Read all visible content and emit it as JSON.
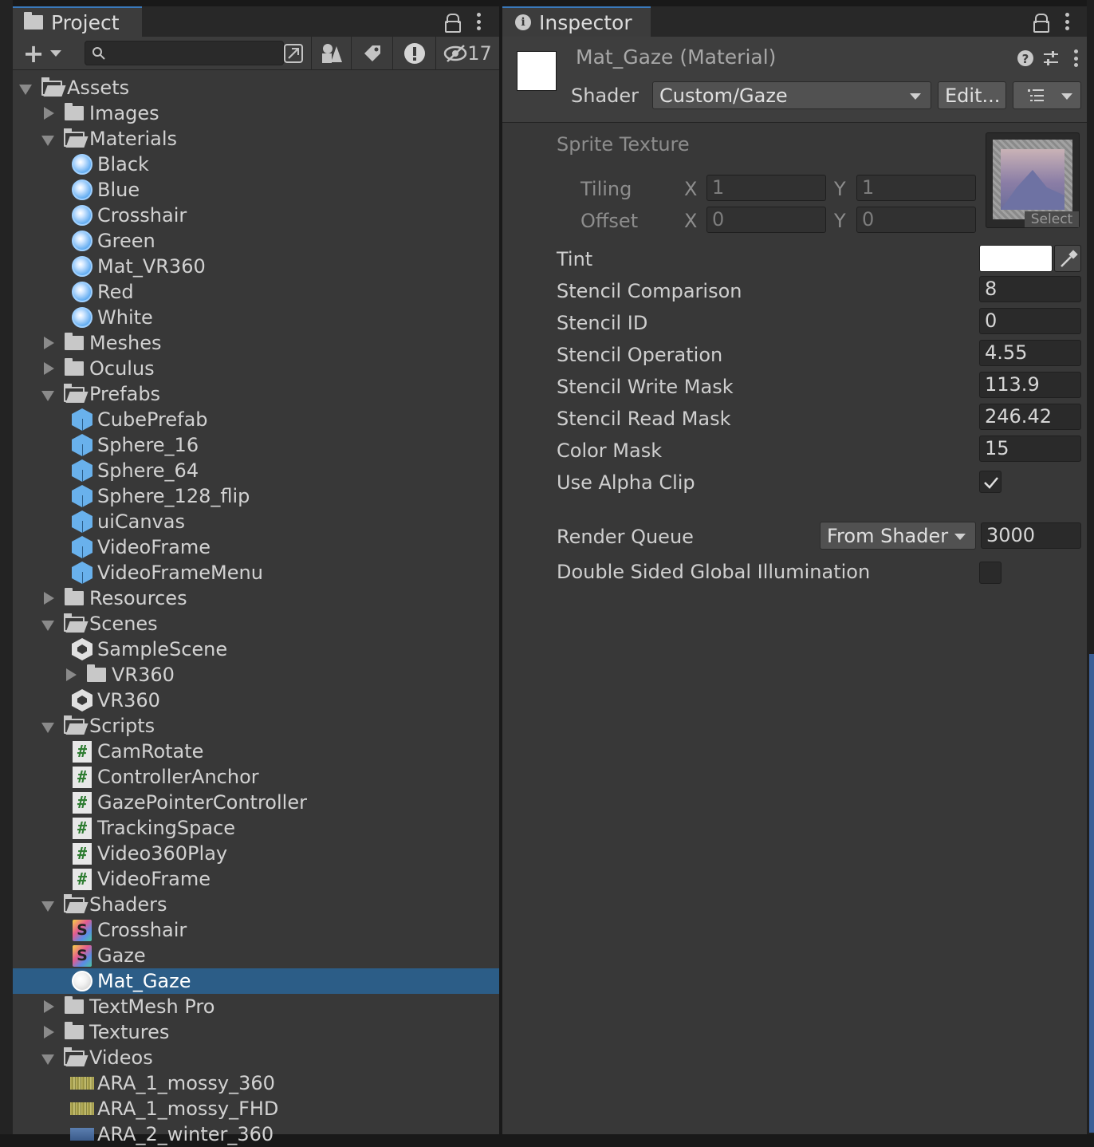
{
  "project": {
    "tab_label": "Project",
    "hidden_count": "17",
    "search_placeholder": "",
    "tree": [
      {
        "label": "Assets",
        "kind": "folder-open",
        "depth": 0,
        "expanded": true
      },
      {
        "label": "Images",
        "kind": "folder",
        "depth": 1,
        "expanded": false
      },
      {
        "label": "Materials",
        "kind": "folder-open",
        "depth": 1,
        "expanded": true
      },
      {
        "label": "Black",
        "kind": "material",
        "depth": 2
      },
      {
        "label": "Blue",
        "kind": "material",
        "depth": 2
      },
      {
        "label": "Crosshair",
        "kind": "material",
        "depth": 2
      },
      {
        "label": "Green",
        "kind": "material",
        "depth": 2
      },
      {
        "label": "Mat_VR360",
        "kind": "material",
        "depth": 2
      },
      {
        "label": "Red",
        "kind": "material",
        "depth": 2
      },
      {
        "label": "White",
        "kind": "material",
        "depth": 2
      },
      {
        "label": "Meshes",
        "kind": "folder",
        "depth": 1,
        "expanded": false
      },
      {
        "label": "Oculus",
        "kind": "folder",
        "depth": 1,
        "expanded": false
      },
      {
        "label": "Prefabs",
        "kind": "folder-open",
        "depth": 1,
        "expanded": true
      },
      {
        "label": "CubePrefab",
        "kind": "prefab",
        "depth": 2
      },
      {
        "label": "Sphere_16",
        "kind": "prefab",
        "depth": 2
      },
      {
        "label": "Sphere_64",
        "kind": "prefab",
        "depth": 2
      },
      {
        "label": "Sphere_128_flip",
        "kind": "prefab",
        "depth": 2
      },
      {
        "label": "uiCanvas",
        "kind": "prefab",
        "depth": 2
      },
      {
        "label": "VideoFrame",
        "kind": "prefab",
        "depth": 2
      },
      {
        "label": "VideoFrameMenu",
        "kind": "prefab",
        "depth": 2
      },
      {
        "label": "Resources",
        "kind": "folder",
        "depth": 1,
        "expanded": false
      },
      {
        "label": "Scenes",
        "kind": "folder-open",
        "depth": 1,
        "expanded": true
      },
      {
        "label": "SampleScene",
        "kind": "scene",
        "depth": 2
      },
      {
        "label": "VR360",
        "kind": "folder",
        "depth": 2,
        "expanded": false
      },
      {
        "label": "VR360",
        "kind": "scene",
        "depth": 2
      },
      {
        "label": "Scripts",
        "kind": "folder-open",
        "depth": 1,
        "expanded": true
      },
      {
        "label": "CamRotate",
        "kind": "script",
        "depth": 2
      },
      {
        "label": "ControllerAnchor",
        "kind": "script",
        "depth": 2
      },
      {
        "label": "GazePointerController",
        "kind": "script",
        "depth": 2
      },
      {
        "label": "TrackingSpace",
        "kind": "script",
        "depth": 2
      },
      {
        "label": "Video360Play",
        "kind": "script",
        "depth": 2
      },
      {
        "label": "VideoFrame",
        "kind": "script",
        "depth": 2
      },
      {
        "label": "Shaders",
        "kind": "folder-open",
        "depth": 1,
        "expanded": true
      },
      {
        "label": "Crosshair",
        "kind": "shader",
        "depth": 2
      },
      {
        "label": "Gaze",
        "kind": "shader",
        "depth": 2
      },
      {
        "label": "Mat_Gaze",
        "kind": "material",
        "depth": 2,
        "selected": true
      },
      {
        "label": "TextMesh Pro",
        "kind": "folder",
        "depth": 1,
        "expanded": false
      },
      {
        "label": "Textures",
        "kind": "folder",
        "depth": 1,
        "expanded": false
      },
      {
        "label": "Videos",
        "kind": "folder-open",
        "depth": 1,
        "expanded": true
      },
      {
        "label": "ARA_1_mossy_360",
        "kind": "video",
        "depth": 2
      },
      {
        "label": "ARA_1_mossy_FHD",
        "kind": "video",
        "depth": 2
      },
      {
        "label": "ARA_2_winter_360",
        "kind": "video-b",
        "depth": 2
      }
    ]
  },
  "inspector": {
    "tab_label": "Inspector",
    "material_name": "Mat_Gaze",
    "material_type": "(Material)",
    "shader_label": "Shader",
    "shader_value": "Custom/Gaze",
    "edit_label": "Edit...",
    "sprite_texture_label": "Sprite Texture",
    "texture_select_label": "Select",
    "tiling_label": "Tiling",
    "offset_label": "Offset",
    "x_label": "X",
    "y_label": "Y",
    "tiling_x": "1",
    "tiling_y": "1",
    "offset_x": "0",
    "offset_y": "0",
    "tint_label": "Tint",
    "tint_color": "#ffffff",
    "properties": [
      {
        "label": "Stencil Comparison",
        "value": "8"
      },
      {
        "label": "Stencil ID",
        "value": "0"
      },
      {
        "label": "Stencil Operation",
        "value": "4.55"
      },
      {
        "label": "Stencil Write Mask",
        "value": "113.9"
      },
      {
        "label": "Stencil Read Mask",
        "value": "246.42"
      },
      {
        "label": "Color Mask",
        "value": "15"
      }
    ],
    "alpha_clip_label": "Use Alpha Clip",
    "alpha_clip_checked": true,
    "render_queue_label": "Render Queue",
    "render_queue_mode": "From Shader",
    "render_queue_value": "3000",
    "dsgi_label": "Double Sided Global Illumination",
    "dsgi_checked": false
  }
}
